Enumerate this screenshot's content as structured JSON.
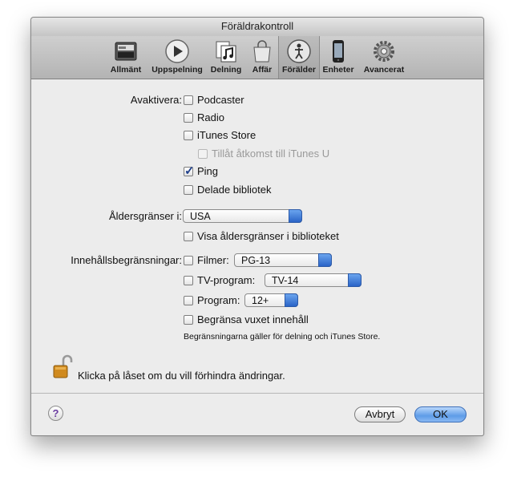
{
  "window": {
    "title": "Föräldrakontroll"
  },
  "toolbar": {
    "items": [
      {
        "label": "Allmänt",
        "icon": "switch-icon"
      },
      {
        "label": "Uppspelning",
        "icon": "play-icon"
      },
      {
        "label": "Delning",
        "icon": "music-sharing-icon"
      },
      {
        "label": "Affär",
        "icon": "shopping-bag-icon"
      },
      {
        "label": "Förälder",
        "icon": "parental-figure-icon",
        "selected": true
      },
      {
        "label": "Enheter",
        "icon": "iphone-icon"
      },
      {
        "label": "Avancerat",
        "icon": "gear-icon"
      }
    ]
  },
  "disable": {
    "label": "Avaktivera:",
    "options": [
      {
        "label": "Podcaster",
        "checked": false
      },
      {
        "label": "Radio",
        "checked": false
      },
      {
        "label": "iTunes Store",
        "checked": false
      },
      {
        "label": "Tillåt åtkomst till iTunes U",
        "checked": false,
        "disabled": true
      },
      {
        "label": "Ping",
        "checked": true
      },
      {
        "label": "Delade bibliotek",
        "checked": false
      }
    ]
  },
  "ratings": {
    "label": "Åldersgränser i:",
    "country": "USA",
    "show_in_library": "Visa åldersgränser i biblioteket"
  },
  "restrictions": {
    "label": "Innehållsbegränsningar:",
    "movies": {
      "label": "Filmer:",
      "value": "PG-13"
    },
    "tv": {
      "label": "TV-program:",
      "value": "TV-14"
    },
    "apps": {
      "label": "Program:",
      "value": "12+"
    },
    "explicit": "Begränsa vuxet innehåll",
    "note": "Begränsningarna gäller för delning och iTunes Store."
  },
  "lock_text": "Klicka på låset om du vill förhindra ändringar.",
  "buttons": {
    "help": "?",
    "cancel": "Avbryt",
    "ok": "OK"
  },
  "colors": {
    "accent": "#3b7fe0",
    "help": "#6a3ca0",
    "lock": "#d08a1e"
  }
}
